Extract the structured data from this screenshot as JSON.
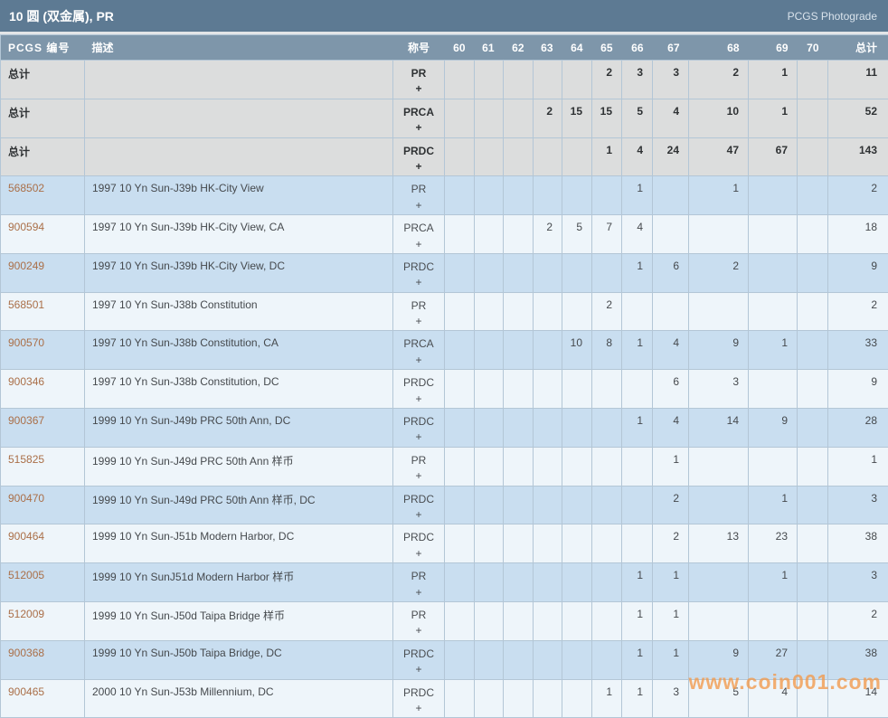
{
  "header": {
    "title": "10 圆 (双金属), PR",
    "brand": "PCGS Photograde"
  },
  "table": {
    "columns": [
      "PCGS 编号",
      "描述",
      "称号",
      "60",
      "61",
      "62",
      "63",
      "64",
      "65",
      "66",
      "67",
      "68",
      "69",
      "70",
      "总计"
    ],
    "grade_keys": [
      "60",
      "61",
      "62",
      "63",
      "64",
      "65",
      "66",
      "67",
      "68",
      "69",
      "70"
    ],
    "designation_plus": "+",
    "rows": [
      {
        "pcgs": "总计",
        "is_total": true,
        "desc": "",
        "designation": "PR",
        "grades": {
          "65": 2,
          "66": 3,
          "67": 3,
          "68": 2,
          "69": 1
        },
        "total": 11
      },
      {
        "pcgs": "总计",
        "is_total": true,
        "desc": "",
        "designation": "PRCA",
        "grades": {
          "63": 2,
          "64": 15,
          "65": 15,
          "66": 5,
          "67": 4,
          "68": 10,
          "69": 1
        },
        "total": 52
      },
      {
        "pcgs": "总计",
        "is_total": true,
        "desc": "",
        "designation": "PRDC",
        "grades": {
          "65": 1,
          "66": 4,
          "67": 24,
          "68": 47,
          "69": 67
        },
        "total": 143
      },
      {
        "pcgs": "568502",
        "is_total": false,
        "desc": "1997 10 Yn Sun-J39b HK-City View",
        "designation": "PR",
        "grades": {
          "66": 1,
          "68": 1
        },
        "total": 2
      },
      {
        "pcgs": "900594",
        "is_total": false,
        "desc": "1997 10 Yn Sun-J39b HK-City View, CA",
        "designation": "PRCA",
        "grades": {
          "63": 2,
          "64": 5,
          "65": 7,
          "66": 4
        },
        "total": 18
      },
      {
        "pcgs": "900249",
        "is_total": false,
        "desc": "1997 10 Yn Sun-J39b HK-City View, DC",
        "designation": "PRDC",
        "grades": {
          "66": 1,
          "67": 6,
          "68": 2
        },
        "total": 9
      },
      {
        "pcgs": "568501",
        "is_total": false,
        "desc": "1997 10 Yn Sun-J38b Constitution",
        "designation": "PR",
        "grades": {
          "65": 2
        },
        "total": 2
      },
      {
        "pcgs": "900570",
        "is_total": false,
        "desc": "1997 10 Yn Sun-J38b Constitution, CA",
        "designation": "PRCA",
        "grades": {
          "64": 10,
          "65": 8,
          "66": 1,
          "67": 4,
          "68": 9,
          "69": 1
        },
        "total": 33
      },
      {
        "pcgs": "900346",
        "is_total": false,
        "desc": "1997 10 Yn Sun-J38b Constitution, DC",
        "designation": "PRDC",
        "grades": {
          "67": 6,
          "68": 3
        },
        "total": 9
      },
      {
        "pcgs": "900367",
        "is_total": false,
        "desc": "1999 10 Yn Sun-J49b PRC 50th Ann, DC",
        "designation": "PRDC",
        "grades": {
          "66": 1,
          "67": 4,
          "68": 14,
          "69": 9
        },
        "total": 28
      },
      {
        "pcgs": "515825",
        "is_total": false,
        "desc": "1999 10 Yn Sun-J49d PRC 50th Ann 样币",
        "designation": "PR",
        "grades": {
          "67": 1
        },
        "total": 1
      },
      {
        "pcgs": "900470",
        "is_total": false,
        "desc": "1999 10 Yn Sun-J49d PRC 50th Ann 样币, DC",
        "designation": "PRDC",
        "grades": {
          "67": 2,
          "69": 1
        },
        "total": 3
      },
      {
        "pcgs": "900464",
        "is_total": false,
        "desc": "1999 10 Yn Sun-J51b Modern Harbor, DC",
        "designation": "PRDC",
        "grades": {
          "67": 2,
          "68": 13,
          "69": 23
        },
        "total": 38
      },
      {
        "pcgs": "512005",
        "is_total": false,
        "desc": "1999 10 Yn SunJ51d Modern Harbor 样币",
        "designation": "PR",
        "grades": {
          "66": 1,
          "67": 1,
          "69": 1
        },
        "total": 3
      },
      {
        "pcgs": "512009",
        "is_total": false,
        "desc": "1999 10 Yn Sun-J50d Taipa Bridge 样币",
        "designation": "PR",
        "grades": {
          "66": 1,
          "67": 1
        },
        "total": 2
      },
      {
        "pcgs": "900368",
        "is_total": false,
        "desc": "1999 10 Yn Sun-J50b Taipa Bridge, DC",
        "designation": "PRDC",
        "grades": {
          "66": 1,
          "67": 1,
          "68": 9,
          "69": 27
        },
        "total": 38
      },
      {
        "pcgs": "900465",
        "is_total": false,
        "desc": "2000 10 Yn Sun-J53b Millennium, DC",
        "designation": "PRDC",
        "grades": {
          "65": 1,
          "66": 1,
          "67": 3,
          "68": 5,
          "69": 4
        },
        "total": 14
      }
    ]
  },
  "watermark": "www.coin001.com",
  "colors": {
    "title-bar": "#5d7a93",
    "title-text": "#ffffff",
    "brand-text": "#d9e3ec",
    "header-bg": "#7e96aa",
    "header-text": "#ffffff",
    "row-total": "#dcdddd",
    "row-blue": "#c9def0",
    "row-light": "#eef5fa",
    "border": "#b3c6d6",
    "link": "#aa6f48",
    "text": "#45494d",
    "watermark": "rgba(242,153,74,0.78)"
  }
}
